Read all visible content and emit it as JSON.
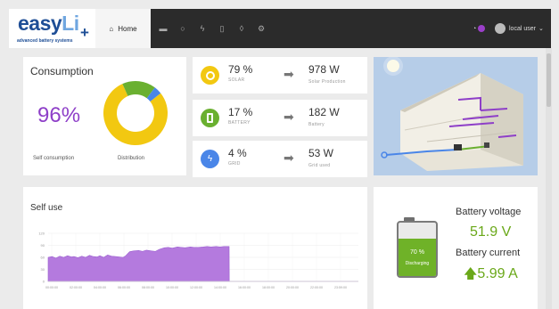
{
  "header": {
    "logo_main": "easy",
    "logo_accent": "Li",
    "logo_plus": "+",
    "logo_subtitle": "advanced battery systems",
    "home_label": "Home",
    "nav_icons": [
      "solar-panel-icon",
      "circle-icon",
      "plug-icon",
      "battery-icon",
      "location-pin-icon",
      "settings-icon"
    ],
    "user_label": "local user"
  },
  "consumption": {
    "title": "Consumption",
    "percent": "96%",
    "self_label": "Self consumption",
    "dist_label": "Distribution",
    "donut": [
      {
        "name": "solar",
        "value": 79,
        "color": "#f2c811"
      },
      {
        "name": "battery",
        "value": 17,
        "color": "#6ab030"
      },
      {
        "name": "grid",
        "value": 4,
        "color": "#4a86e8"
      }
    ]
  },
  "stats": [
    {
      "icon": "sun-icon",
      "color": "#f2c811",
      "percent": "79 %",
      "label": "SOLAR",
      "value": "978 W",
      "sub": "Solar Production"
    },
    {
      "icon": "battery-icon",
      "color": "#6ab030",
      "percent": "17 %",
      "label": "BATTERY",
      "value": "182 W",
      "sub": "Battery"
    },
    {
      "icon": "plug-icon",
      "color": "#4a86e8",
      "percent": "4 %",
      "label": "GRID",
      "value": "53 W",
      "sub": "Grid used"
    }
  ],
  "selfuse": {
    "title": "Self use",
    "yticks": [
      "120",
      "90",
      "60",
      "30",
      "0"
    ],
    "xticks": [
      "00:00:00",
      "02:00:00",
      "04:00:00",
      "06:00:00",
      "08:00:00",
      "10:00:00",
      "12:00:00",
      "14:00:00",
      "16:00:00",
      "18:00:00",
      "20:00:00",
      "22:00:00",
      "23:59:00"
    ],
    "chart_data": {
      "type": "area",
      "ylim": [
        0,
        120
      ],
      "color": "#b47ade",
      "x": [
        0,
        0.3,
        0.6,
        0.9,
        1.2,
        1.5,
        1.8,
        2.0,
        2.3,
        2.6,
        2.9,
        3.2,
        3.5,
        3.8,
        4.0,
        4.3,
        4.6,
        4.9,
        5.2,
        5.5,
        5.8,
        6.0,
        6.3,
        6.6,
        7.0,
        7.3,
        7.6,
        8.0,
        8.3,
        8.6,
        9.0,
        9.3,
        9.6,
        10.0,
        10.3,
        10.6,
        11.0,
        11.3,
        11.6,
        12.0,
        12.3,
        12.6,
        13.0,
        13.3,
        13.6,
        14.0,
        14.01,
        23.99
      ],
      "values": [
        60,
        62,
        58,
        63,
        60,
        64,
        61,
        62,
        59,
        63,
        60,
        65,
        62,
        61,
        64,
        60,
        66,
        63,
        62,
        61,
        60,
        64,
        74,
        76,
        77,
        75,
        78,
        76,
        75,
        80,
        84,
        85,
        83,
        86,
        85,
        84,
        86,
        85,
        85,
        86,
        87,
        86,
        87,
        86,
        87,
        87,
        0,
        0
      ]
    }
  },
  "battery": {
    "voltage_label": "Battery voltage",
    "voltage_value": "51.9 V",
    "current_label": "Battery current",
    "current_value": "5.99 A",
    "level_text": "70 %",
    "level_fraction": 0.7,
    "state_text": "Discharging"
  }
}
